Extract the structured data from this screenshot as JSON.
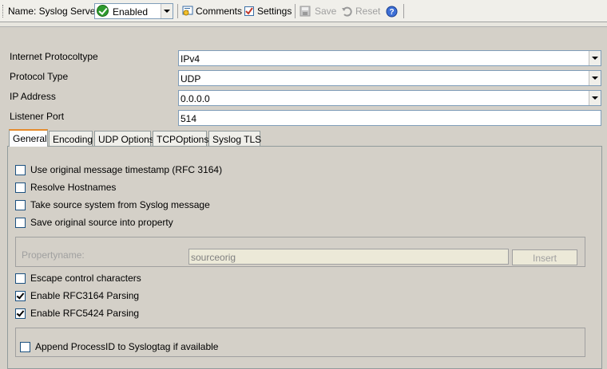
{
  "toolbar": {
    "name_label": "Name: Syslog Server",
    "status_value": "Enabled",
    "comments_label": "Comments",
    "settings_label": "Settings",
    "save_label": "Save",
    "reset_label": "Reset"
  },
  "form": {
    "protocoltype_label": "Internet Protocoltype",
    "protocoltype_value": "IPv4",
    "protocol_label": "Protocol Type",
    "protocol_value": "UDP",
    "ip_label": "IP Address",
    "ip_value": "0.0.0.0",
    "port_label": "Listener Port",
    "port_value": "514"
  },
  "tabs": [
    {
      "label": "General",
      "active": true
    },
    {
      "label": "Encoding"
    },
    {
      "label": "UDP Options"
    },
    {
      "label": "TCPOptions"
    },
    {
      "label": "Syslog TLS"
    }
  ],
  "general": {
    "checkboxes": [
      {
        "label": "Use original message timestamp (RFC 3164)",
        "checked": false
      },
      {
        "label": "Resolve Hostnames",
        "checked": false
      },
      {
        "label": "Take source system from Syslog message",
        "checked": false
      },
      {
        "label": "Save original source into property",
        "checked": false
      }
    ],
    "propertyname_label": "Propertyname:",
    "propertyname_value": "sourceorig",
    "insert_label": "Insert",
    "checkboxes2": [
      {
        "label": "Escape control characters",
        "checked": false
      },
      {
        "label": "Enable RFC3164 Parsing",
        "checked": true
      },
      {
        "label": "Enable RFC5424 Parsing",
        "checked": true
      }
    ],
    "append_label": "Append ProcessID to Syslogtag if available",
    "append_checked": false
  }
}
